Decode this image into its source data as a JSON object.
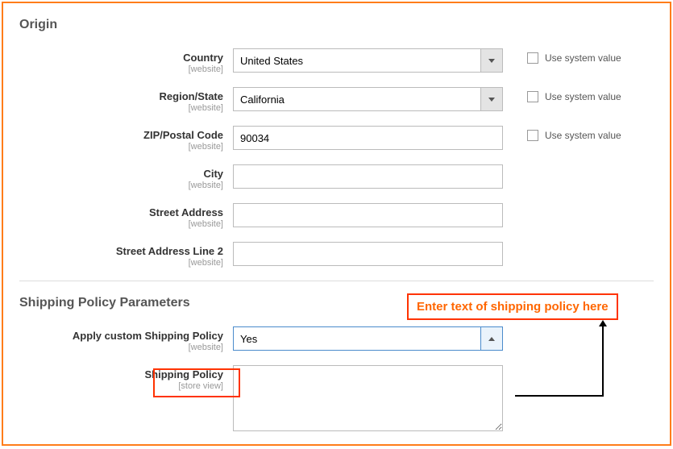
{
  "origin": {
    "title": "Origin",
    "country": {
      "label": "Country",
      "scope": "[website]",
      "value": "United States",
      "checkbox_label": "Use system value"
    },
    "region": {
      "label": "Region/State",
      "scope": "[website]",
      "value": "California",
      "checkbox_label": "Use system value"
    },
    "zip": {
      "label": "ZIP/Postal Code",
      "scope": "[website]",
      "value": "90034",
      "checkbox_label": "Use system value"
    },
    "city": {
      "label": "City",
      "scope": "[website]",
      "value": ""
    },
    "street1": {
      "label": "Street Address",
      "scope": "[website]",
      "value": ""
    },
    "street2": {
      "label": "Street Address Line 2",
      "scope": "[website]",
      "value": ""
    }
  },
  "shipping": {
    "title": "Shipping Policy Parameters",
    "apply": {
      "label": "Apply custom Shipping Policy",
      "scope": "[website]",
      "value": "Yes"
    },
    "policy": {
      "label": "Shipping Policy",
      "scope": "[store view]",
      "value": ""
    }
  },
  "annotation": {
    "text": "Enter text of shipping policy here"
  }
}
